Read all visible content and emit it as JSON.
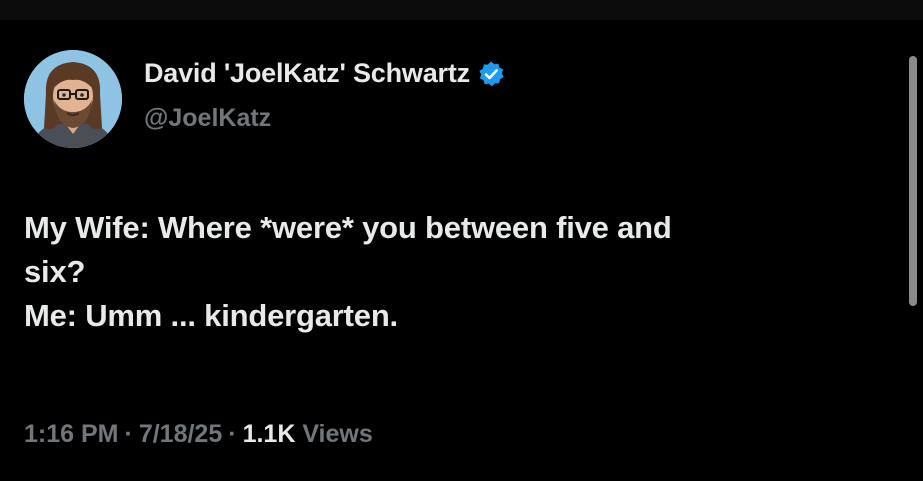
{
  "author": {
    "display_name": "David 'JoelKatz' Schwartz",
    "handle": "@JoelKatz",
    "avatar_icon": "cartoon-man-with-long-hair-and-glasses",
    "verified_icon": "verified-badge-icon",
    "verified_color": "#1d9bf0"
  },
  "tweet": {
    "lines": [
      "My Wife: Where *were* you between five and",
      "six?",
      "Me: Umm ... kindergarten."
    ]
  },
  "meta": {
    "time": "1:16 PM",
    "date": "7/18/25",
    "separator": "·",
    "views_count": "1.1K",
    "views_label": "Views"
  },
  "colors": {
    "background": "#000000",
    "primary_text": "#e7e9ea",
    "secondary_text": "#71767b"
  }
}
